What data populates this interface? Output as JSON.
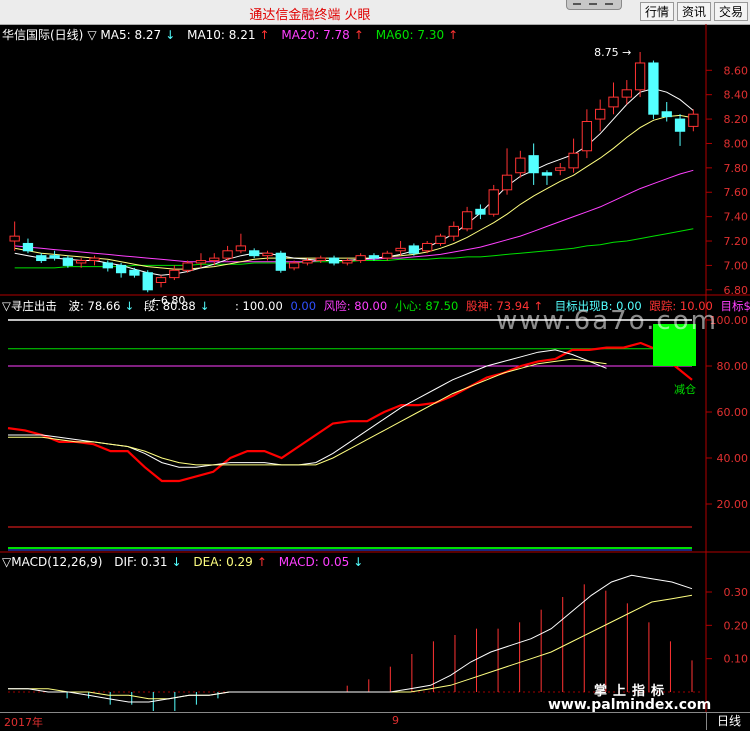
{
  "app": {
    "title": "通达信金融终端  火眼"
  },
  "toolbar": {
    "buttons": [
      "行情",
      "资讯",
      "交易"
    ]
  },
  "main_panel": {
    "header": {
      "name": "华信国际(日线)",
      "ma5": "MA5: 8.27",
      "ma10": "MA10: 8.21",
      "ma20": "MA20: 7.78",
      "ma60": "MA60: 7.30"
    },
    "annotations": {
      "high": "8.75",
      "low": "6.80"
    },
    "y_ticks": [
      "8.60",
      "8.40",
      "8.20",
      "8.00",
      "7.80",
      "7.60",
      "7.40",
      "7.20",
      "7.00",
      "6.80"
    ]
  },
  "indicator_panel": {
    "header": {
      "name": "寻庄出击",
      "wave": "波: 78.66",
      "segment": "段: 80.88",
      "line100": ": 100.00",
      "zero": "0.00",
      "risk": "风险: 80.00",
      "caution": "小心: 87.50",
      "god": "股神: 73.94",
      "signal": "目标出现B: 0.00",
      "follow": "跟踪: 10.00",
      "target": "目标$"
    },
    "label_reduce": "减仓",
    "y_ticks": [
      "100.00",
      "80.00",
      "60.00",
      "40.00",
      "20.00"
    ]
  },
  "macd_panel": {
    "header": {
      "name": "MACD(12,26,9)",
      "dif": "DIF: 0.31",
      "dea": "DEA: 0.29",
      "macd": "MACD: 0.05"
    },
    "y_ticks": [
      "0.30",
      "0.20",
      "0.10"
    ]
  },
  "footer": {
    "year": "2017年",
    "month": "9",
    "period": "日线"
  },
  "watermarks": {
    "site1": "www.6a7o.com",
    "site2_title": "掌上指标",
    "site2_url": "www.palmindex.com"
  },
  "chart_data": [
    {
      "type": "candlestick",
      "title": "华信国际(日线)",
      "ylim": [
        6.7,
        8.75
      ],
      "candles": [
        [
          7.2,
          7.36,
          7.24,
          7.12
        ],
        [
          7.18,
          7.22,
          7.12,
          7.1
        ],
        [
          7.08,
          7.1,
          7.04,
          7.02
        ],
        [
          7.08,
          7.12,
          7.06,
          7.04
        ],
        [
          7.06,
          7.08,
          7.0,
          6.98
        ],
        [
          7.02,
          7.06,
          7.04,
          6.98
        ],
        [
          7.04,
          7.08,
          7.06,
          7.0
        ],
        [
          7.02,
          7.04,
          6.98,
          6.95
        ],
        [
          7.0,
          7.02,
          6.94,
          6.9
        ],
        [
          6.96,
          6.98,
          6.92,
          6.9
        ],
        [
          6.94,
          6.96,
          6.8,
          6.78
        ],
        [
          6.86,
          6.92,
          6.9,
          6.82
        ],
        [
          6.9,
          7.0,
          6.96,
          6.88
        ],
        [
          6.96,
          7.04,
          7.02,
          6.94
        ],
        [
          7.02,
          7.1,
          7.04,
          6.98
        ],
        [
          7.04,
          7.1,
          7.06,
          7.0
        ],
        [
          7.06,
          7.16,
          7.12,
          7.04
        ],
        [
          7.12,
          7.26,
          7.16,
          7.1
        ],
        [
          7.12,
          7.14,
          7.08,
          7.06
        ],
        [
          7.08,
          7.12,
          7.1,
          7.04
        ],
        [
          7.1,
          7.12,
          6.96,
          6.94
        ],
        [
          6.98,
          7.04,
          7.02,
          6.96
        ],
        [
          7.02,
          7.06,
          7.04,
          7.0
        ],
        [
          7.04,
          7.08,
          7.06,
          7.02
        ],
        [
          7.06,
          7.08,
          7.02,
          7.0
        ],
        [
          7.02,
          7.06,
          7.04,
          7.0
        ],
        [
          7.04,
          7.1,
          7.08,
          7.02
        ],
        [
          7.08,
          7.1,
          7.06,
          7.04
        ],
        [
          7.06,
          7.12,
          7.1,
          7.04
        ],
        [
          7.12,
          7.2,
          7.14,
          7.08
        ],
        [
          7.16,
          7.18,
          7.1,
          7.08
        ],
        [
          7.12,
          7.2,
          7.18,
          7.1
        ],
        [
          7.18,
          7.26,
          7.24,
          7.16
        ],
        [
          7.24,
          7.36,
          7.32,
          7.2
        ],
        [
          7.3,
          7.48,
          7.44,
          7.28
        ],
        [
          7.46,
          7.5,
          7.42,
          7.38
        ],
        [
          7.42,
          7.66,
          7.62,
          7.4
        ],
        [
          7.62,
          7.96,
          7.74,
          7.58
        ],
        [
          7.76,
          7.94,
          7.88,
          7.72
        ],
        [
          7.9,
          8.0,
          7.76,
          7.66
        ],
        [
          7.76,
          7.78,
          7.74,
          7.66
        ],
        [
          7.78,
          7.84,
          7.8,
          7.74
        ],
        [
          7.8,
          8.04,
          7.92,
          7.76
        ],
        [
          7.94,
          8.28,
          8.18,
          7.88
        ],
        [
          8.2,
          8.36,
          8.28,
          8.1
        ],
        [
          8.3,
          8.5,
          8.38,
          8.24
        ],
        [
          8.38,
          8.52,
          8.44,
          8.32
        ],
        [
          8.44,
          8.75,
          8.66,
          8.38
        ],
        [
          8.66,
          8.68,
          8.24,
          8.2
        ],
        [
          8.26,
          8.34,
          8.22,
          8.18
        ],
        [
          8.2,
          8.24,
          8.1,
          7.98
        ],
        [
          8.14,
          8.28,
          8.24,
          8.1
        ]
      ],
      "ma5": [
        7.1,
        7.08,
        7.06,
        7.06,
        7.05,
        7.04,
        7.04,
        7.02,
        7.0,
        6.97,
        6.94,
        6.92,
        6.93,
        6.95,
        6.98,
        7.01,
        7.05,
        7.08,
        7.1,
        7.1,
        7.08,
        7.06,
        7.05,
        7.04,
        7.04,
        7.04,
        7.05,
        7.06,
        7.07,
        7.09,
        7.12,
        7.15,
        7.2,
        7.26,
        7.34,
        7.43,
        7.54,
        7.65,
        7.73,
        7.78,
        7.83,
        7.87,
        7.91,
        7.98,
        8.08,
        8.2,
        8.32,
        8.42,
        8.45,
        8.42,
        8.36,
        8.27
      ],
      "ma10": [
        7.14,
        7.12,
        7.1,
        7.09,
        7.08,
        7.07,
        7.06,
        7.05,
        7.03,
        7.01,
        6.99,
        6.98,
        6.97,
        6.97,
        6.98,
        6.99,
        7.01,
        7.03,
        7.05,
        7.06,
        7.06,
        7.06,
        7.06,
        7.06,
        7.06,
        7.06,
        7.06,
        7.06,
        7.07,
        7.08,
        7.09,
        7.11,
        7.14,
        7.18,
        7.23,
        7.29,
        7.35,
        7.42,
        7.5,
        7.57,
        7.63,
        7.69,
        7.74,
        7.81,
        7.88,
        7.96,
        8.05,
        8.13,
        8.19,
        8.22,
        8.23,
        8.21
      ],
      "ma20": [
        7.16,
        7.15,
        7.14,
        7.13,
        7.12,
        7.11,
        7.1,
        7.09,
        7.08,
        7.07,
        7.06,
        7.05,
        7.04,
        7.03,
        7.03,
        7.03,
        7.03,
        7.03,
        7.03,
        7.03,
        7.03,
        7.03,
        7.03,
        7.04,
        7.04,
        7.04,
        7.05,
        7.05,
        7.06,
        7.06,
        7.07,
        7.08,
        7.09,
        7.11,
        7.13,
        7.15,
        7.18,
        7.21,
        7.24,
        7.28,
        7.32,
        7.36,
        7.4,
        7.44,
        7.48,
        7.53,
        7.58,
        7.63,
        7.67,
        7.71,
        7.75,
        7.78
      ],
      "ma60": [
        6.98,
        6.98,
        6.98,
        6.98,
        6.99,
        6.99,
        6.99,
        6.99,
        6.99,
        7.0,
        7.0,
        7.0,
        7.0,
        7.0,
        7.01,
        7.01,
        7.01,
        7.01,
        7.02,
        7.02,
        7.02,
        7.02,
        7.03,
        7.03,
        7.03,
        7.03,
        7.04,
        7.04,
        7.04,
        7.05,
        7.05,
        7.05,
        7.06,
        7.06,
        7.07,
        7.07,
        7.08,
        7.09,
        7.1,
        7.11,
        7.12,
        7.13,
        7.14,
        7.16,
        7.17,
        7.19,
        7.2,
        7.22,
        7.24,
        7.26,
        7.28,
        7.3
      ]
    },
    {
      "type": "line",
      "title": "寻庄出击",
      "ylim": [
        0,
        100
      ],
      "levels": {
        "top": 100,
        "caution": 87.5,
        "risk": 80,
        "follow": 10,
        "bottom": 0
      },
      "series": [
        {
          "name": "股神",
          "values": [
            53,
            52,
            50,
            47,
            47,
            46,
            43,
            43,
            36,
            30,
            30,
            32,
            34,
            40,
            43,
            43,
            40,
            45,
            50,
            55,
            56,
            56,
            60,
            63,
            63,
            64,
            67,
            71,
            75,
            77,
            80,
            82,
            83,
            87,
            87,
            88,
            88,
            90,
            87,
            80,
            74
          ]
        },
        {
          "name": "波",
          "values": [
            50,
            50,
            50,
            49,
            48,
            47,
            46,
            45,
            42,
            38,
            36,
            36,
            37,
            38,
            38,
            38,
            37,
            37,
            38,
            42,
            47,
            52,
            57,
            62,
            66,
            70,
            74,
            77,
            80,
            82,
            84,
            86,
            87,
            85,
            82,
            79
          ]
        },
        {
          "name": "段",
          "values": [
            49,
            49,
            49,
            48,
            47,
            47,
            46,
            45,
            43,
            40,
            38,
            37,
            37,
            37,
            37,
            37,
            37,
            37,
            37,
            40,
            44,
            48,
            52,
            56,
            60,
            64,
            68,
            71,
            74,
            77,
            79,
            81,
            82,
            83,
            82,
            81
          ]
        }
      ],
      "signal_box": {
        "from": 80,
        "to": 100
      }
    },
    {
      "type": "line",
      "title": "MACD(12,26,9)",
      "ylim": [
        -0.06,
        0.36
      ],
      "series": [
        {
          "name": "DIF",
          "values": [
            0.01,
            0.01,
            0.0,
            0.0,
            -0.01,
            -0.02,
            -0.03,
            -0.03,
            -0.02,
            -0.01,
            -0.01,
            0.0,
            0.0,
            0.0,
            0.0,
            0.0,
            0.0,
            0.0,
            0.0,
            0.0,
            0.01,
            0.02,
            0.05,
            0.09,
            0.12,
            0.14,
            0.16,
            0.19,
            0.24,
            0.29,
            0.33,
            0.35,
            0.34,
            0.33,
            0.31
          ]
        },
        {
          "name": "DEA",
          "values": [
            0.01,
            0.01,
            0.01,
            0.0,
            0.0,
            -0.01,
            -0.01,
            -0.02,
            -0.02,
            -0.01,
            -0.01,
            0.0,
            0.0,
            0.0,
            0.0,
            0.0,
            0.0,
            0.0,
            0.0,
            0.0,
            0.0,
            0.01,
            0.02,
            0.04,
            0.06,
            0.08,
            0.1,
            0.12,
            0.15,
            0.18,
            0.21,
            0.24,
            0.27,
            0.28,
            0.29
          ]
        },
        {
          "name": "MACD",
          "values": [
            0.0,
            0.0,
            -0.01,
            -0.01,
            -0.02,
            -0.02,
            -0.03,
            -0.03,
            -0.02,
            -0.01,
            0.0,
            0.0,
            0.0,
            0.0,
            0.0,
            0.01,
            0.02,
            0.04,
            0.06,
            0.08,
            0.09,
            0.1,
            0.1,
            0.11,
            0.13,
            0.15,
            0.17,
            0.16,
            0.14,
            0.11,
            0.08,
            0.05
          ]
        }
      ]
    }
  ],
  "colors": {
    "up": "#ff3333",
    "down": "#54ffff",
    "ma5": "#ffffff",
    "ma10": "#ffff80",
    "ma20": "#ff40ff",
    "ma60": "#00e000",
    "god": "#ff0000",
    "grid_red": "#a00000"
  }
}
